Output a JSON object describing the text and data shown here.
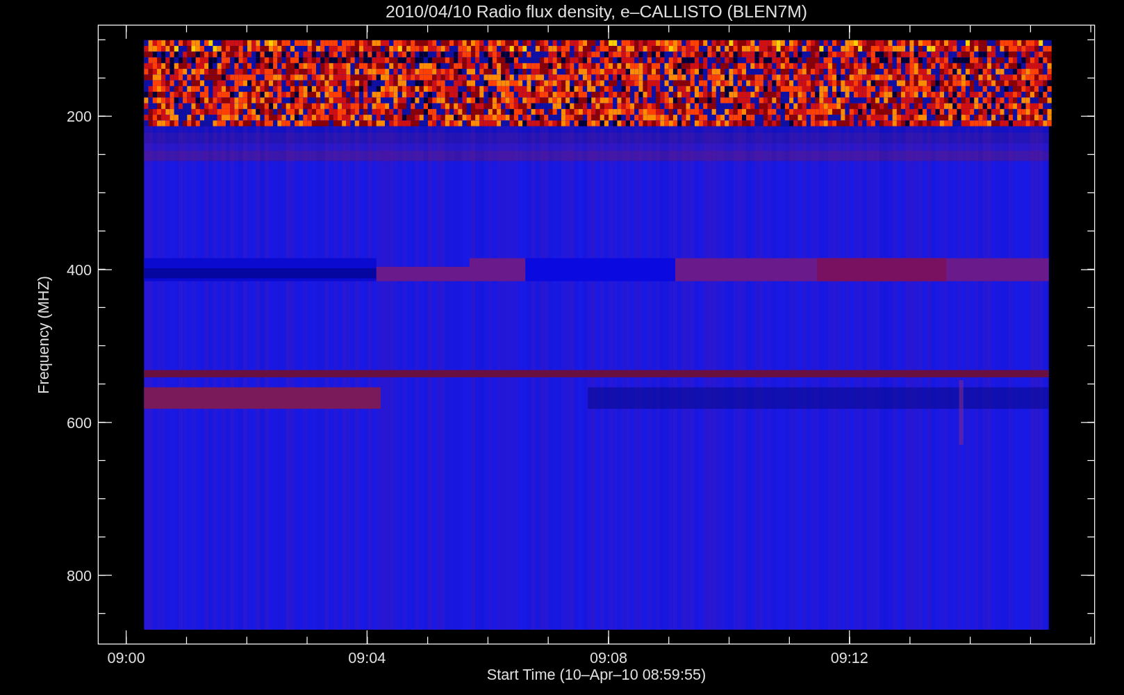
{
  "plot": {
    "title": "2010/04/10  Radio flux density, e–CALLISTO (BLEN7M)",
    "y_axis_label": "Frequency (MHZ)",
    "x_axis_label": "Start Time (10–Apr–10 08:59:55)",
    "y_tick_labels": [
      "200",
      "400",
      "600",
      "800"
    ],
    "x_tick_labels": [
      "09:00",
      "09:04",
      "09:08",
      "09:12"
    ]
  }
}
